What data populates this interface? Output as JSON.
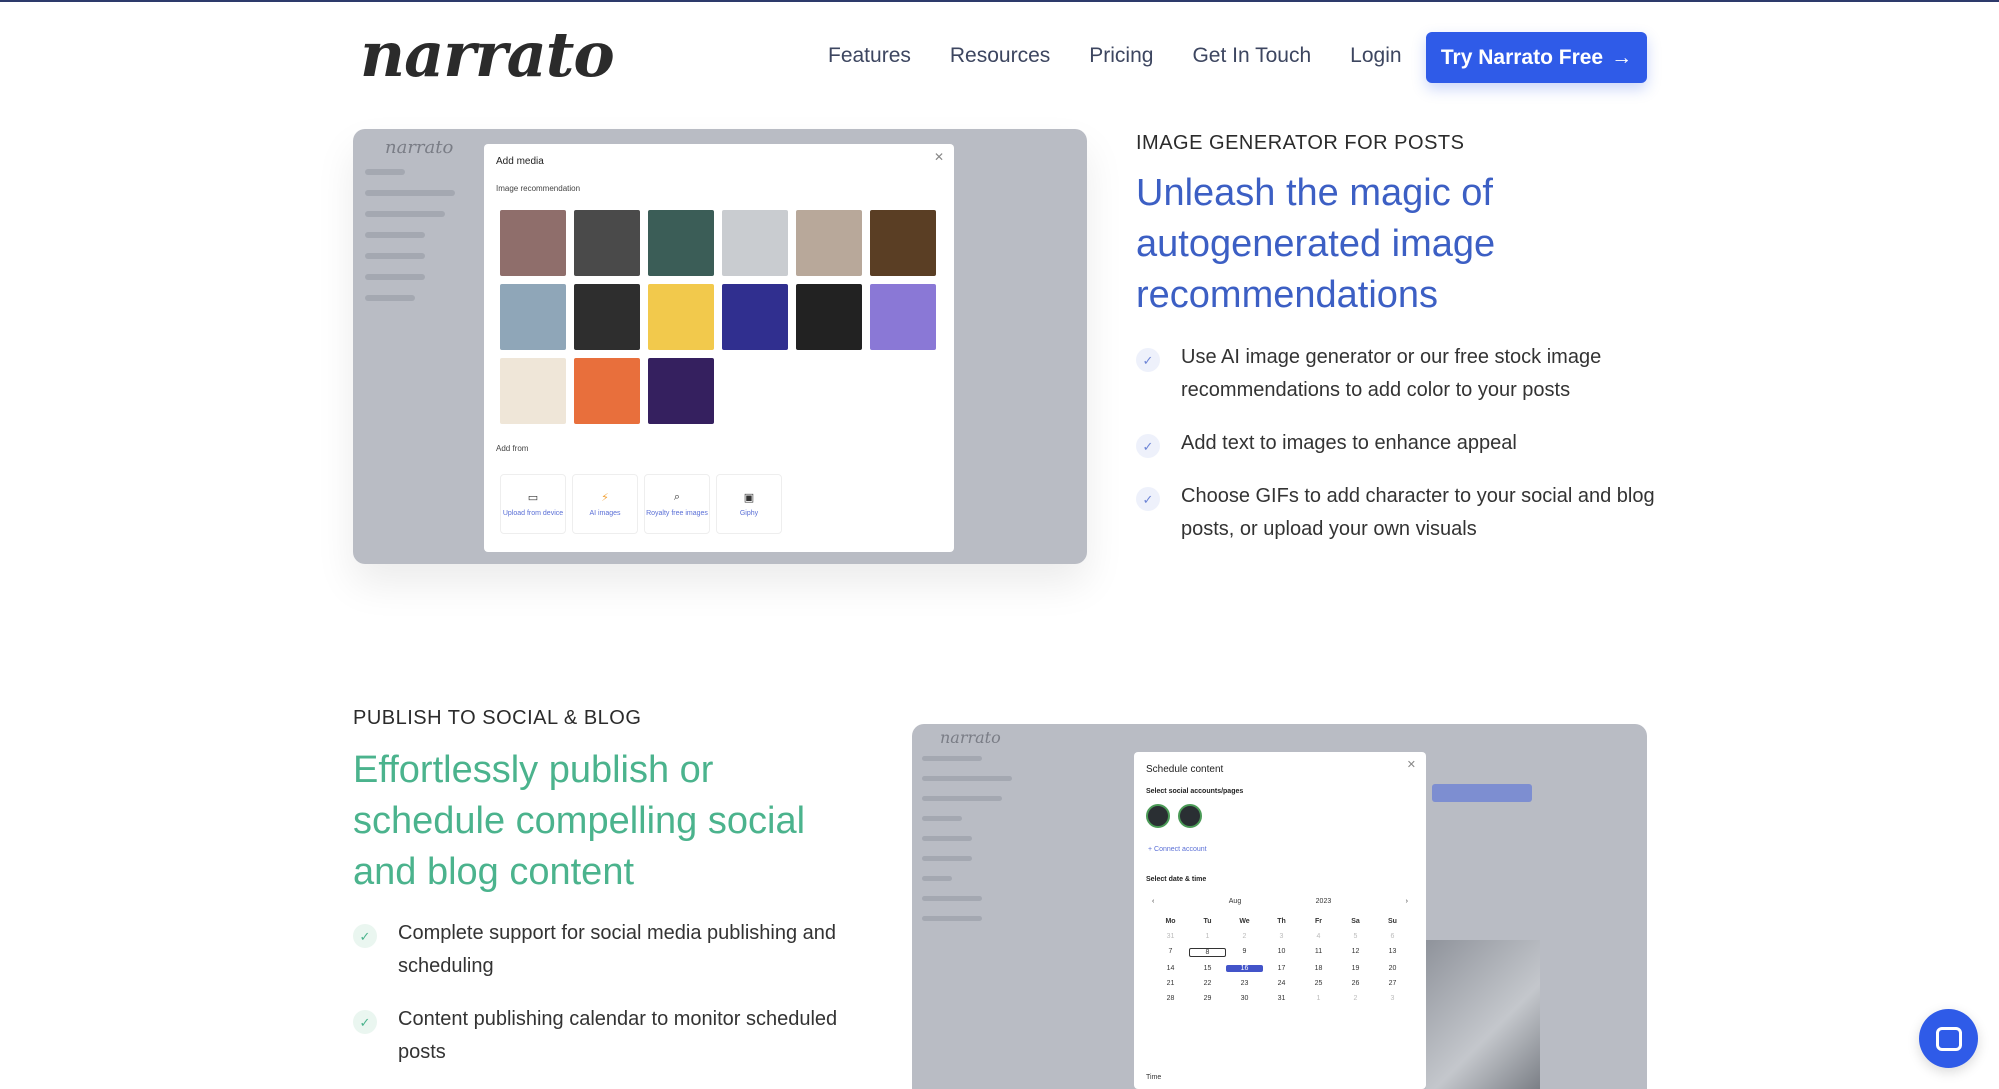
{
  "header": {
    "logo_text": "narrato",
    "nav": [
      "Features",
      "Resources",
      "Pricing",
      "Get In Touch",
      "Login"
    ],
    "cta_label": "Try Narrato Free",
    "cta_icon": "arrow-right-icon"
  },
  "section_image": {
    "eyebrow": "IMAGE GENERATOR FOR POSTS",
    "headline": "Unleash the magic of autogenerated image recommendations",
    "headline_color": "#3c5fc4",
    "bullets": [
      "Use AI image generator or our free stock image recommendations to add color to your posts",
      "Add text to images to enhance appeal",
      "Choose GIFs to add character to your social and blog posts, or upload your own visuals"
    ],
    "mockup": {
      "logo_text": "narrato",
      "modal_title": "Add media",
      "modal_subtitle": "Image recommendation",
      "add_from_label": "Add from",
      "sources": [
        {
          "icon": "monitor-icon",
          "label": "Upload from device"
        },
        {
          "icon": "lightning-icon",
          "label": "AI images"
        },
        {
          "icon": "search-icon",
          "label": "Royalty free images"
        },
        {
          "icon": "gif-icon",
          "label": "Giphy"
        }
      ],
      "thumb_colors": [
        "#8f6e6b",
        "#4a4a4a",
        "#3b5d57",
        "#c9ccd0",
        "#b8a89a",
        "#5a3e24",
        "#8fa6b8",
        "#2e2e2e",
        "#f2c94c",
        "#302f8f",
        "#222222",
        "#8a78d6",
        "#efe6d8",
        "#e86f3c",
        "#35205f"
      ]
    }
  },
  "section_publish": {
    "eyebrow": "PUBLISH TO SOCIAL & BLOG",
    "headline": "Effortlessly publish or schedule compelling social and blog content",
    "headline_color": "#4bb38d",
    "bullets": [
      "Complete support for social media publishing and scheduling",
      "Content publishing calendar to monitor scheduled posts"
    ],
    "mockup": {
      "logo_text": "narrato",
      "modal_title": "Schedule content",
      "accounts_label": "Select social accounts/pages",
      "connect_label": "+ Connect account",
      "date_label": "Select date & time",
      "month": "Aug",
      "year": "2023",
      "weekdays": [
        "Mo",
        "Tu",
        "We",
        "Th",
        "Fr",
        "Sa",
        "Su"
      ],
      "days": [
        "31",
        "1",
        "2",
        "3",
        "4",
        "5",
        "6",
        "7",
        "8",
        "9",
        "10",
        "11",
        "12",
        "13",
        "14",
        "15",
        "16",
        "17",
        "18",
        "19",
        "20",
        "21",
        "22",
        "23",
        "24",
        "25",
        "26",
        "27",
        "28",
        "29",
        "30",
        "31",
        "1",
        "2",
        "3"
      ],
      "time_label": "Time"
    }
  },
  "chat": {
    "icon": "chat-icon"
  }
}
